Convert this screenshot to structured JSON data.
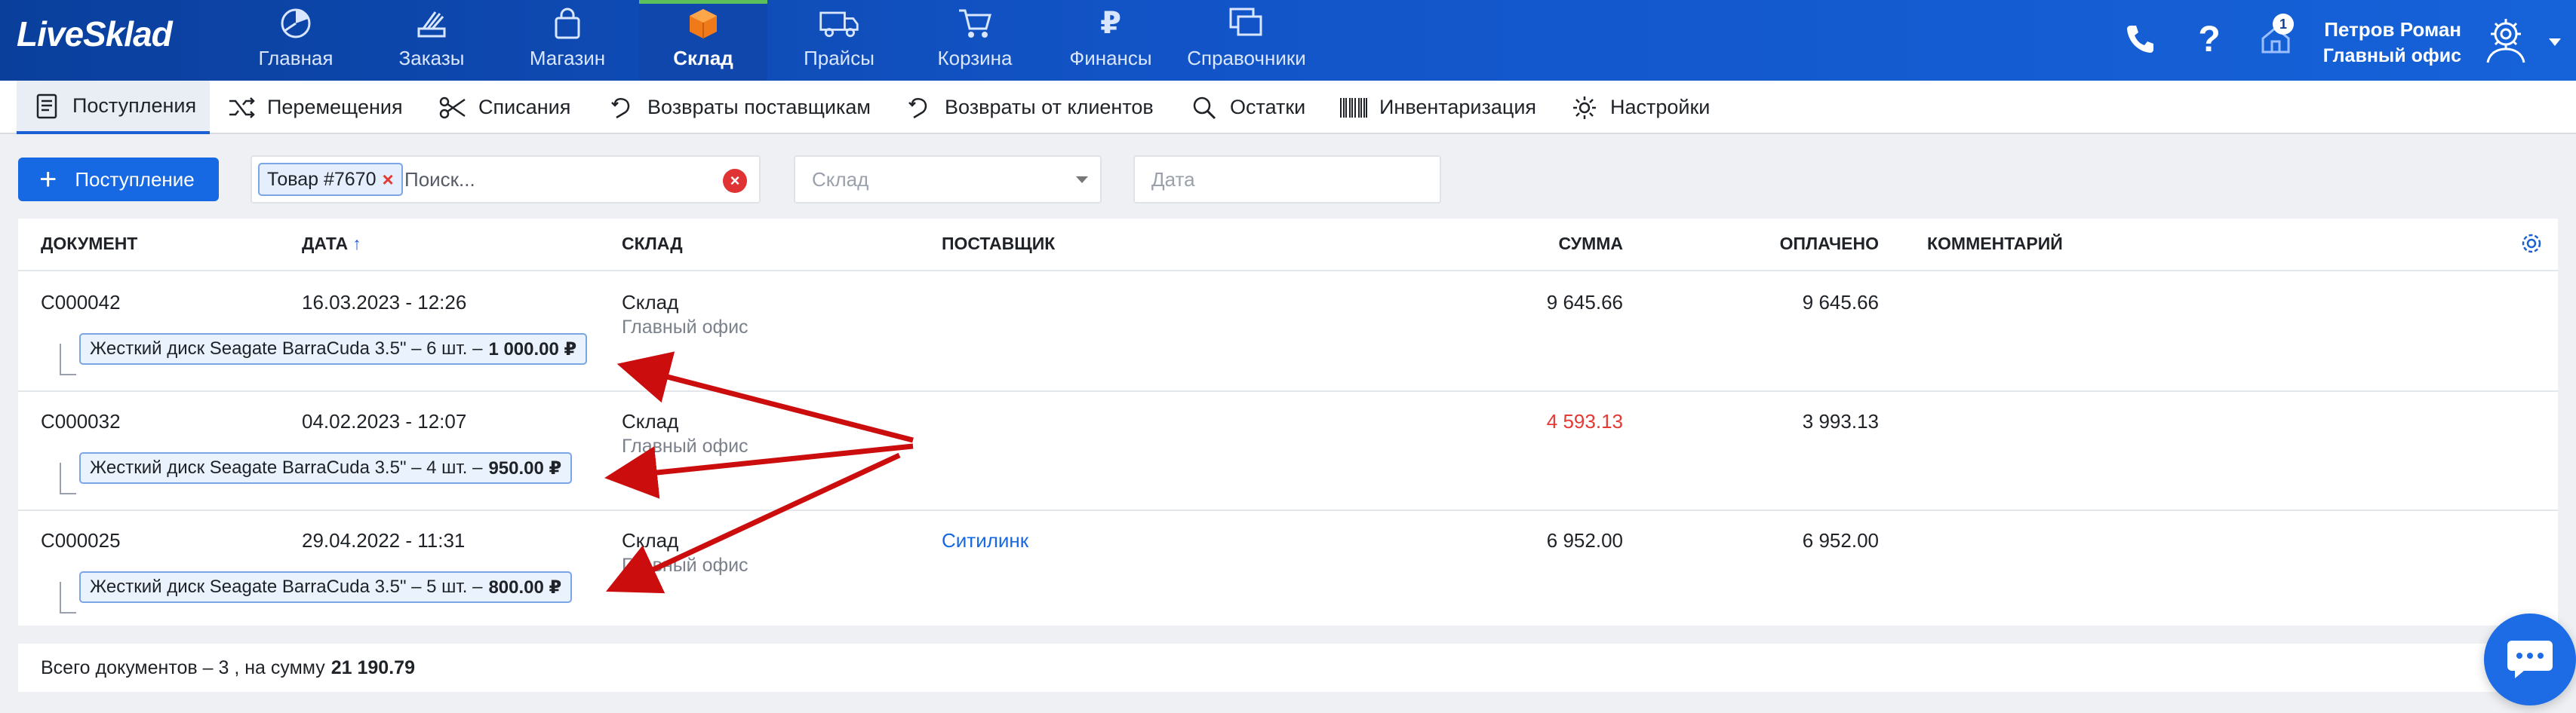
{
  "app": {
    "logo": "LiveSklad"
  },
  "nav": [
    {
      "label": "Главная",
      "icon": "dashboard-icon"
    },
    {
      "label": "Заказы",
      "icon": "orders-icon"
    },
    {
      "label": "Магазин",
      "icon": "shop-bag-icon"
    },
    {
      "label": "Склад",
      "icon": "warehouse-box-icon",
      "active": true
    },
    {
      "label": "Прайсы",
      "icon": "truck-icon"
    },
    {
      "label": "Корзина",
      "icon": "cart-icon"
    },
    {
      "label": "Финансы",
      "icon": "ruble-icon"
    },
    {
      "label": "Справочники",
      "icon": "directory-icon"
    }
  ],
  "header": {
    "notification_count": "1",
    "user_name": "Петров Роман",
    "user_office": "Главный офис",
    "colors": {
      "topbar": "#1254c7",
      "active_marker": "#5cc15c"
    }
  },
  "subnav": [
    {
      "label": "Поступления",
      "icon": "document-icon",
      "active": true
    },
    {
      "label": "Перемещения",
      "icon": "shuffle-icon"
    },
    {
      "label": "Списания",
      "icon": "scissors-icon"
    },
    {
      "label": "Возвраты поставщикам",
      "icon": "return-icon"
    },
    {
      "label": "Возвраты от клиентов",
      "icon": "return-icon"
    },
    {
      "label": "Остатки",
      "icon": "search-icon"
    },
    {
      "label": "Инвентаризация",
      "icon": "barcode-icon"
    },
    {
      "label": "Настройки",
      "icon": "gear-icon"
    }
  ],
  "filters": {
    "add_button": "Поступление",
    "chip_label": "Товар #7670",
    "chip_remove": "×",
    "search_placeholder": "Поиск...",
    "warehouse_placeholder": "Склад",
    "date_placeholder": "Дата"
  },
  "table": {
    "columns": {
      "document": "ДОКУМЕНТ",
      "date": "ДАТА",
      "date_sort": "↑",
      "warehouse": "СКЛАД",
      "supplier": "ПОСТАВЩИК",
      "sum": "СУММА",
      "paid": "ОПЛАЧЕНО",
      "comment": "КОММЕНТАРИЙ"
    },
    "rows": [
      {
        "document": "С000042",
        "date": "16.03.2023 - 12:26",
        "warehouse": "Склад",
        "office": "Главный офис",
        "supplier": "",
        "sum": "9 645.66",
        "sum_overdue": false,
        "paid": "9 645.66",
        "item": "Жесткий диск Seagate BarraCuda 3.5\" – 6 шт. –",
        "item_price": "1 000.00 ₽"
      },
      {
        "document": "С000032",
        "date": "04.02.2023 - 12:07",
        "warehouse": "Склад",
        "office": "Главный офис",
        "supplier": "",
        "sum": "4 593.13",
        "sum_overdue": true,
        "paid": "3 993.13",
        "item": "Жесткий диск Seagate BarraCuda 3.5\" – 4 шт. –",
        "item_price": "950.00 ₽"
      },
      {
        "document": "С000025",
        "date": "29.04.2022 - 11:31",
        "warehouse": "Склад",
        "office": "Главный офис",
        "supplier": "Ситилинк",
        "sum": "6 952.00",
        "sum_overdue": false,
        "paid": "6 952.00",
        "item": "Жесткий диск Seagate BarraCuda 3.5\" – 5 шт. –",
        "item_price": "800.00 ₽"
      }
    ]
  },
  "footer": {
    "text": "Всего документов – 3 , на сумму",
    "total": "21 190.79"
  },
  "annotation": {
    "arrow_color": "#cc0d0d"
  }
}
